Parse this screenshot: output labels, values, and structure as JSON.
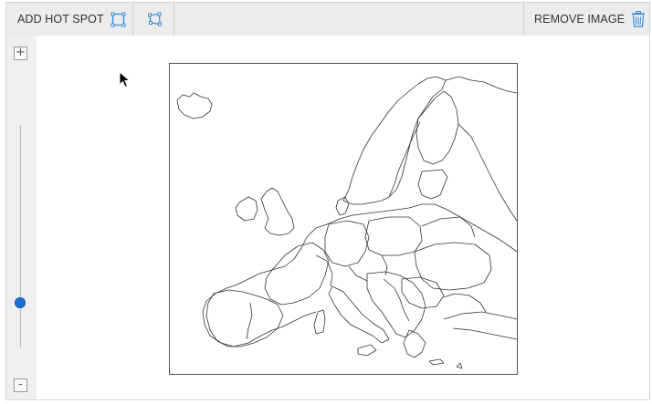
{
  "toolbar": {
    "add_hotspot_label": "ADD HOT SPOT",
    "remove_image_label": "REMOVE IMAGE",
    "icons": {
      "rect_hotspot": "rectangle-hotspot-icon",
      "polygon_hotspot": "polygon-hotspot-icon",
      "trash": "trash-icon"
    }
  },
  "zoom": {
    "plus_label": "+",
    "minus_label": "-",
    "level": 0.2
  },
  "image": {
    "subject": "outline map of Europe"
  },
  "colors": {
    "accent": "#1f6fd1",
    "toolbar_bg": "#ececec",
    "icon_blue": "#3a8ad6"
  }
}
